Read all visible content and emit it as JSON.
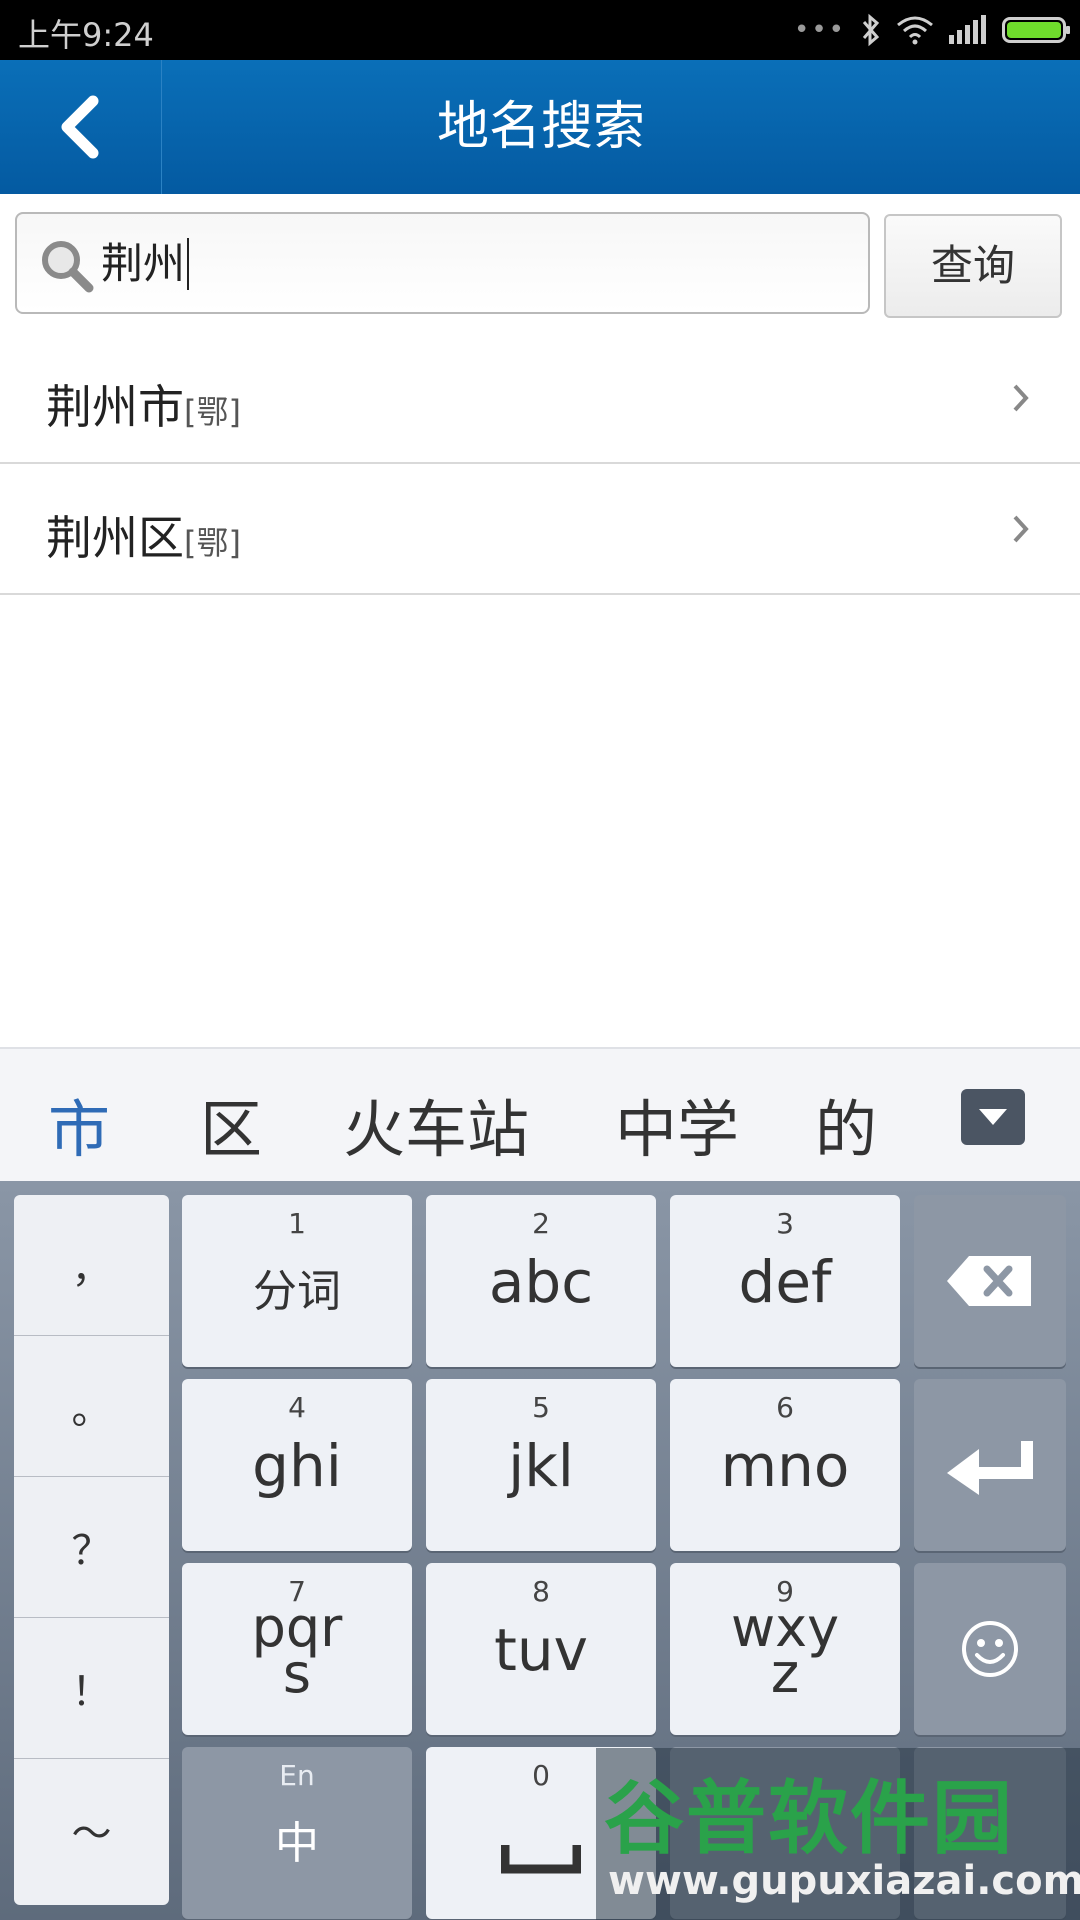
{
  "status_bar": {
    "time": "上午9:24"
  },
  "header": {
    "title": "地名搜索"
  },
  "search": {
    "value": "荆州",
    "button_label": "查询"
  },
  "results": [
    {
      "name": "荆州市",
      "tag": "[鄂]"
    },
    {
      "name": "荆州区",
      "tag": "[鄂]"
    }
  ],
  "keyboard": {
    "candidates": [
      "市",
      "区",
      "火车站",
      "中学",
      "的"
    ],
    "punctuation": [
      "，",
      "。",
      "？",
      "！",
      "～"
    ],
    "keys": [
      {
        "num": "1",
        "label": "分词"
      },
      {
        "num": "2",
        "label": "abc"
      },
      {
        "num": "3",
        "label": "def"
      },
      {
        "num": "4",
        "label": "ghi"
      },
      {
        "num": "5",
        "label": "jkl"
      },
      {
        "num": "6",
        "label": "mno"
      },
      {
        "num": "7",
        "label": "pqr\ns"
      },
      {
        "num": "8",
        "label": "tuv"
      },
      {
        "num": "9",
        "label": "wxy\nz"
      },
      {
        "num": "0",
        "label": ""
      }
    ],
    "lang_key": {
      "top": "En",
      "main": "中"
    },
    "icons": [
      "backspace-icon",
      "enter-icon",
      "emoji-icon",
      "space-icon"
    ]
  },
  "watermark": {
    "title": "谷普软件园",
    "url": "www.gupuxiazai.com"
  },
  "colors": {
    "header_blue": "#0a6fb8",
    "candidate_active": "#2f6bb6",
    "battery_green": "#6fdc2c"
  }
}
